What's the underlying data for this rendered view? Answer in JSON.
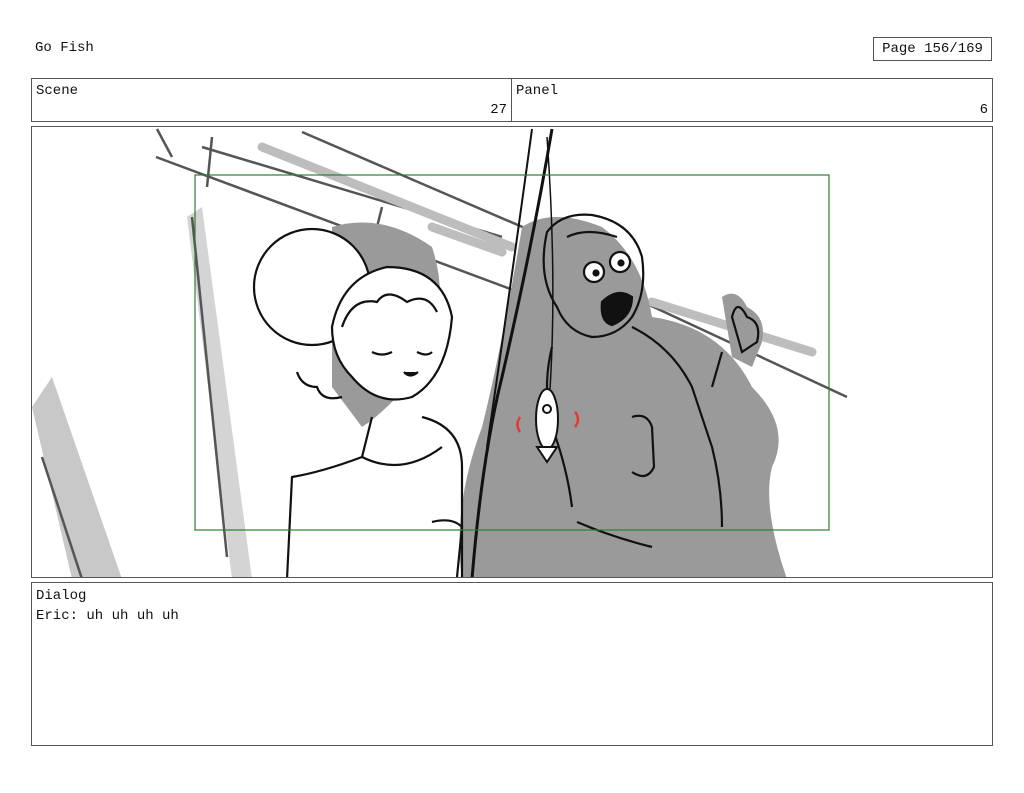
{
  "header": {
    "title": "Go Fish",
    "page": "Page 156/169"
  },
  "scene": {
    "label": "Scene",
    "value": "27"
  },
  "panel": {
    "label": "Panel",
    "value": "6"
  },
  "dialog": {
    "label": "Dialog",
    "text": "Eric: uh uh uh uh"
  },
  "colors": {
    "frame_border": "#555555",
    "safe_area": "#2e7d32",
    "shadow_gray": "#9a9a9a",
    "light_gray": "#c8c8c8",
    "accent_red": "#e53935"
  }
}
